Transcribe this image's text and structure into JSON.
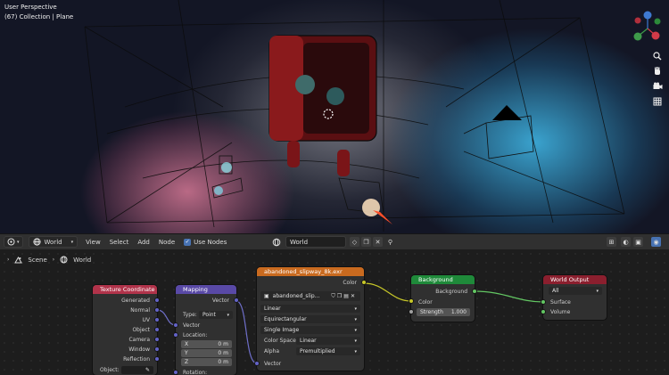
{
  "viewport": {
    "perspective_label": "User Perspective",
    "collection_label": "(67) Collection | Plane",
    "gizmo_axes": [
      "X",
      "Y",
      "Z"
    ],
    "tool_icons": [
      "zoom-icon",
      "hand-icon",
      "camera-icon",
      "grid-icon"
    ]
  },
  "header": {
    "editor_type_icon": "node-editor-icon",
    "shader_type": "World",
    "menus": [
      "View",
      "Select",
      "Add",
      "Node"
    ],
    "use_nodes_label": "Use Nodes",
    "use_nodes_checked": true,
    "world_name": "World"
  },
  "breadcrumb": {
    "scene": "Scene",
    "world": "World"
  },
  "nodes": {
    "texcoord": {
      "title": "Texture Coordinate",
      "outputs": [
        "Generated",
        "Normal",
        "UV",
        "Object",
        "Camera",
        "Window",
        "Reflection"
      ],
      "object_label": "Object:"
    },
    "mapping": {
      "title": "Mapping",
      "output": "Vector",
      "type_label": "Type:",
      "type_value": "Point",
      "vector_input": "Vector",
      "location_label": "Location:",
      "loc": [
        {
          "axis": "X",
          "value": "0 m"
        },
        {
          "axis": "Y",
          "value": "0 m"
        },
        {
          "axis": "Z",
          "value": "0 m"
        }
      ],
      "rotation_label": "Rotation:"
    },
    "image": {
      "title": "abandoned_slipway_8k.exr",
      "output": "Color",
      "image_name": "abandoned_slip...",
      "interpolation": "Linear",
      "projection": "Equirectangular",
      "source": "Single Image",
      "color_space_label": "Color Space",
      "color_space": "Linear",
      "alpha_label": "Alpha",
      "alpha": "Premultiplied",
      "vector_input": "Vector"
    },
    "background": {
      "title": "Background",
      "output": "Background",
      "color_input": "Color",
      "strength_label": "Strength",
      "strength_value": "1.000"
    },
    "output": {
      "title": "World Output",
      "target": "All",
      "surface": "Surface",
      "volume": "Volume"
    }
  },
  "colors": {
    "texcoord_header": "#b1334a",
    "mapping_header": "#5949a6",
    "image_header": "#c96a1f",
    "background_header": "#1f8a3a",
    "output_header": "#8b1f2e",
    "socket_vector": "#6363c7",
    "socket_color": "#c7c729",
    "socket_shader": "#63c763",
    "socket_float": "#a1a1a1"
  }
}
